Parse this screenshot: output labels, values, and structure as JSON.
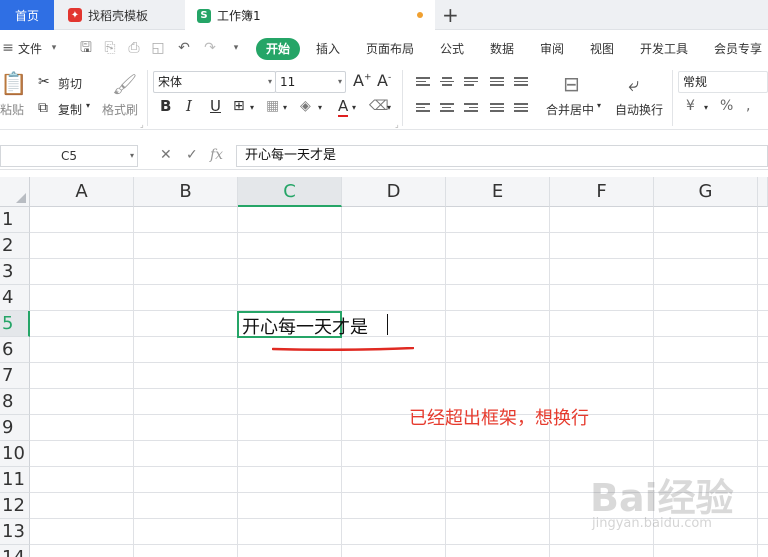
{
  "tabs": {
    "home": "首页",
    "templates": "找稻壳模板",
    "workbook": "工作簿1"
  },
  "menu": {
    "file": "文件",
    "start": "开始",
    "insert": "插入",
    "page_layout": "页面布局",
    "formula": "公式",
    "data": "数据",
    "review": "审阅",
    "view": "视图",
    "developer": "开发工具",
    "member": "会员专享"
  },
  "ribbon": {
    "paste": "粘贴",
    "cut": "剪切",
    "copy": "复制",
    "format_painter": "格式刷",
    "font_name": "宋体",
    "font_size": "11",
    "merge_center": "合并居中",
    "wrap_text": "自动换行",
    "number_format": "常规",
    "bold": "B",
    "italic": "I",
    "underline": "U",
    "grow_font": "A",
    "shrink_font": "A",
    "font_color": "A",
    "currency": "¥",
    "percent": "%"
  },
  "formula_bar": {
    "cell_ref": "C5",
    "content": "开心每一天才是"
  },
  "grid": {
    "columns": [
      "A",
      "B",
      "C",
      "D",
      "E",
      "F",
      "G"
    ],
    "rows": [
      "1",
      "2",
      "3",
      "4",
      "5",
      "6",
      "7",
      "8",
      "9",
      "10",
      "11",
      "12",
      "13",
      "14"
    ],
    "active_column": "C",
    "active_row": "5",
    "cell_c5": "开心每一天才是"
  },
  "annotation": "已经超出框架，想换行",
  "watermark": {
    "logo": "Bai经验",
    "url": "jingyan.baidu.com"
  },
  "colors": {
    "accent_green": "#25a567",
    "tab_blue": "#2f6fe4",
    "annotation_red": "#e63b2e"
  }
}
